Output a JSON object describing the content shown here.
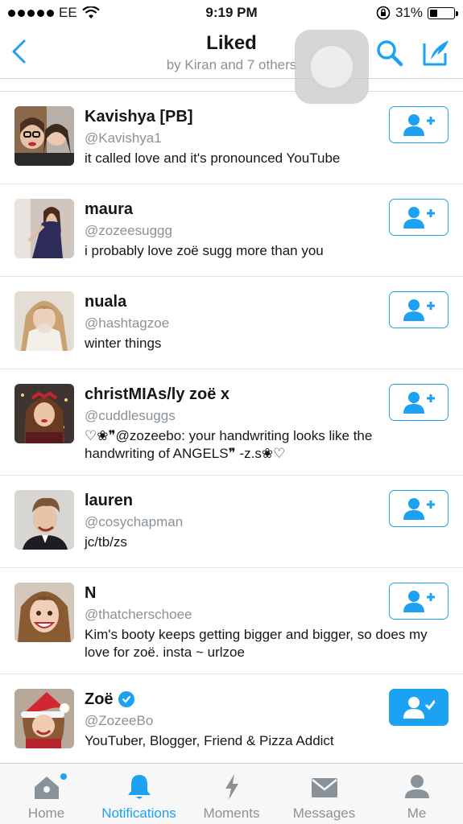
{
  "status": {
    "carrier": "EE",
    "time": "9:19 PM",
    "battery": "31%",
    "battery_level": 0.31
  },
  "nav": {
    "title": "Liked",
    "subtitle": "by Kiran and 7 others"
  },
  "users": [
    {
      "name": "Kavishya [PB]",
      "handle": "@Kavishya1",
      "bio": "it called love and it's pronounced YouTube",
      "verified": false,
      "following": false
    },
    {
      "name": "maura",
      "handle": "@zozeesuggg",
      "bio": "i probably love zoë sugg more than you",
      "verified": false,
      "following": false
    },
    {
      "name": "nuala",
      "handle": "@hashtagzoe",
      "bio": "winter things",
      "verified": false,
      "following": false
    },
    {
      "name": "christMIAs/ly zoë x",
      "handle": "@cuddlesuggs",
      "bio": "♡❀❞@zozeebo: your handwriting looks like the handwriting of ANGELS❞ -z.s❀♡",
      "verified": false,
      "following": false
    },
    {
      "name": "lauren",
      "handle": "@cosychapman",
      "bio": "jc/tb/zs",
      "verified": false,
      "following": false
    },
    {
      "name": "N",
      "handle": "@thatcherschoee",
      "bio": "Kim's booty keeps getting bigger and bigger, so does my love for zoë. insta ~ urlzoe",
      "verified": false,
      "following": false
    },
    {
      "name": "Zoë",
      "handle": "@ZozeeBo",
      "bio": "YouTuber, Blogger, Friend & Pizza Addict",
      "verified": true,
      "following": true
    }
  ],
  "tabs": [
    {
      "label": "Home",
      "icon": "home-icon"
    },
    {
      "label": "Notifications",
      "icon": "bell-icon"
    },
    {
      "label": "Moments",
      "icon": "lightning-icon"
    },
    {
      "label": "Messages",
      "icon": "envelope-icon"
    },
    {
      "label": "Me",
      "icon": "person-icon"
    }
  ],
  "colors": {
    "accent": "#1da1f2",
    "text": "#14171a",
    "secondary": "#8a9299"
  }
}
